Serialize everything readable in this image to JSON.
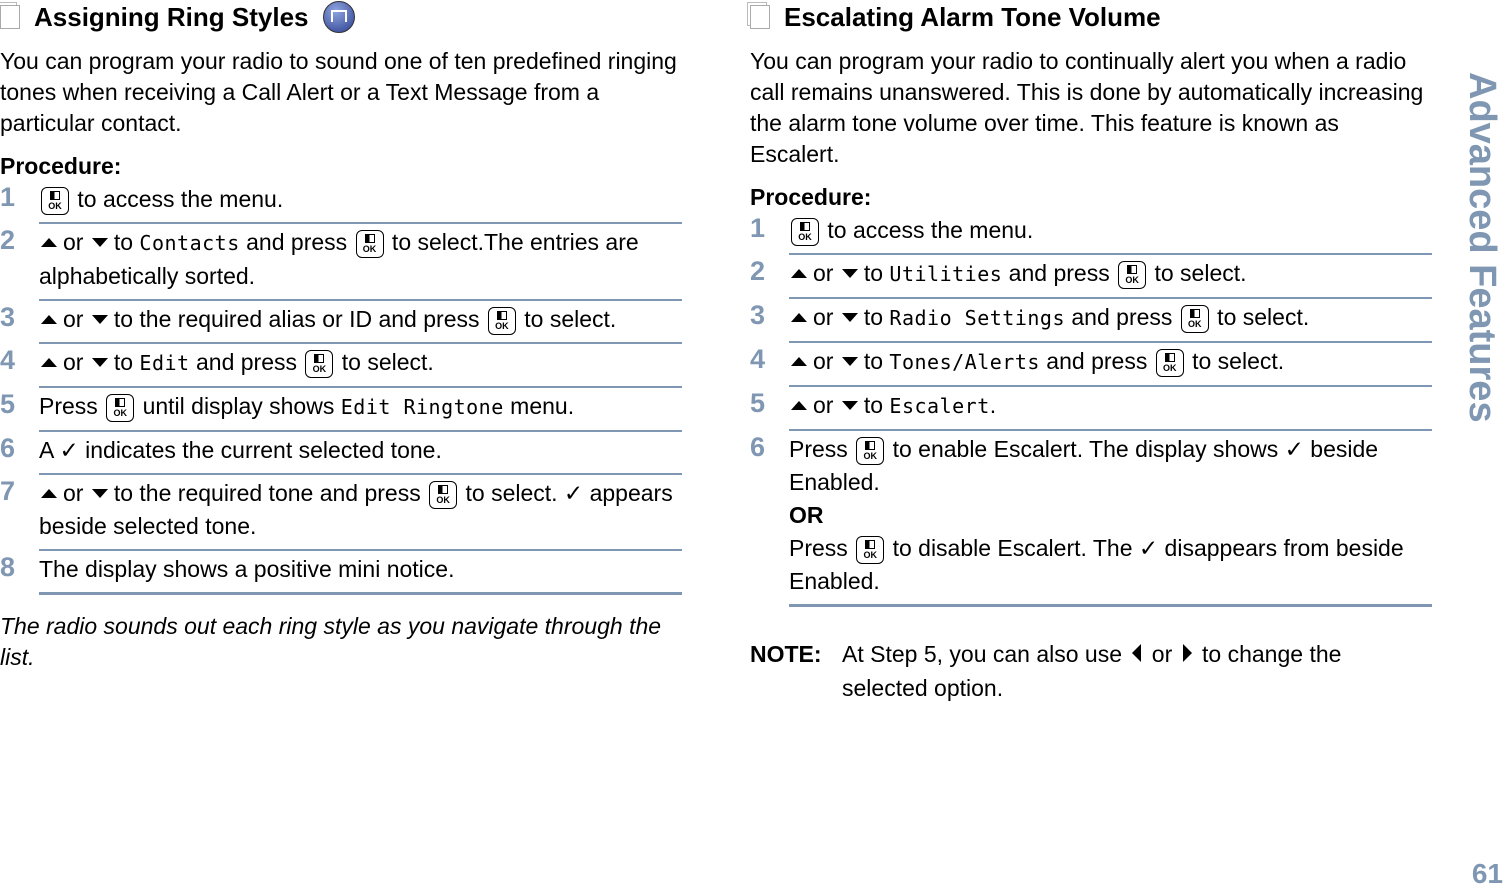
{
  "side_tab": "Advanced Features",
  "page_number": "61",
  "left": {
    "title": "Assigning Ring Styles",
    "intro": "You can program your radio to sound one of ten predefined ringing tones when receiving a Call Alert or a Text Message from a particular contact.",
    "procedure_label": "Procedure:",
    "steps": [
      {
        "n": "1",
        "segs": [
          {
            "k": "ok"
          },
          {
            "t": " to access the menu."
          }
        ]
      },
      {
        "n": "2",
        "segs": [
          {
            "k": "up"
          },
          {
            "t": "or "
          },
          {
            "k": "down"
          },
          {
            "t": "to "
          },
          {
            "m": "Contacts"
          },
          {
            "t": " and press "
          },
          {
            "k": "ok"
          },
          {
            "t": " to select.The entries are alphabetically sorted."
          }
        ]
      },
      {
        "n": "3",
        "segs": [
          {
            "k": "up"
          },
          {
            "t": "or "
          },
          {
            "k": "down"
          },
          {
            "t": "to the required alias or ID and press "
          },
          {
            "k": "ok"
          },
          {
            "t": " to select."
          }
        ]
      },
      {
        "n": "4",
        "segs": [
          {
            "k": "up"
          },
          {
            "t": "or "
          },
          {
            "k": "down"
          },
          {
            "t": "to "
          },
          {
            "m": "Edit"
          },
          {
            "t": " and press "
          },
          {
            "k": "ok"
          },
          {
            "t": " to select."
          }
        ]
      },
      {
        "n": "5",
        "segs": [
          {
            "t": "Press "
          },
          {
            "k": "ok"
          },
          {
            "t": " until display shows "
          },
          {
            "m": "Edit Ringtone"
          },
          {
            "t": " menu."
          }
        ]
      },
      {
        "n": "6",
        "segs": [
          {
            "t": "A ✓ indicates the current selected tone."
          }
        ]
      },
      {
        "n": "7",
        "segs": [
          {
            "k": "up"
          },
          {
            "t": "or "
          },
          {
            "k": "down"
          },
          {
            "t": "to the required tone and press "
          },
          {
            "k": "ok"
          },
          {
            "t": " to select. ✓ appears beside selected tone."
          }
        ]
      },
      {
        "n": "8",
        "segs": [
          {
            "t": "The display shows a positive mini notice."
          }
        ]
      }
    ],
    "footer": "The radio sounds out each ring style as you navigate through the list."
  },
  "right": {
    "title": "Escalating Alarm Tone Volume",
    "intro": "You can program your radio to continually alert you when a radio call remains unanswered. This is done by automatically increasing the alarm tone volume over time. This feature is known as Escalert.",
    "procedure_label": "Procedure:",
    "steps": [
      {
        "n": "1",
        "segs": [
          {
            "k": "ok"
          },
          {
            "t": " to access the menu."
          }
        ]
      },
      {
        "n": "2",
        "segs": [
          {
            "k": "up"
          },
          {
            "t": "or "
          },
          {
            "k": "down"
          },
          {
            "t": "to "
          },
          {
            "m": "Utilities"
          },
          {
            "t": " and press "
          },
          {
            "k": "ok"
          },
          {
            "t": " to select."
          }
        ]
      },
      {
        "n": "3",
        "segs": [
          {
            "k": "up"
          },
          {
            "t": "or "
          },
          {
            "k": "down"
          },
          {
            "t": "to "
          },
          {
            "m": "Radio Settings"
          },
          {
            "t": " and press "
          },
          {
            "k": "ok"
          },
          {
            "t": " to select."
          }
        ]
      },
      {
        "n": "4",
        "segs": [
          {
            "k": "up"
          },
          {
            "t": "or "
          },
          {
            "k": "down"
          },
          {
            "t": "to "
          },
          {
            "m": "Tones/Alerts"
          },
          {
            "t": " and press "
          },
          {
            "k": "ok"
          },
          {
            "t": " to select."
          }
        ]
      },
      {
        "n": "5",
        "segs": [
          {
            "k": "up"
          },
          {
            "t": "or "
          },
          {
            "k": "down"
          },
          {
            "t": "to "
          },
          {
            "m": "Escalert"
          },
          {
            "t": "."
          }
        ]
      },
      {
        "n": "6",
        "segs": [
          {
            "t": "Press "
          },
          {
            "k": "ok"
          },
          {
            "t": " to enable Escalert. The display shows ✓ beside Enabled."
          },
          {
            "br": true
          },
          {
            "b": "OR"
          },
          {
            "br": true
          },
          {
            "t": "Press "
          },
          {
            "k": "ok"
          },
          {
            "t": " to disable Escalert. The ✓ disappears from beside Enabled."
          }
        ]
      }
    ],
    "note_label": "NOTE:",
    "note_segs": [
      {
        "t": "At Step 5, you can also use "
      },
      {
        "k": "left"
      },
      {
        "t": " or "
      },
      {
        "k": "right"
      },
      {
        "t": " to change the selected option."
      }
    ]
  }
}
